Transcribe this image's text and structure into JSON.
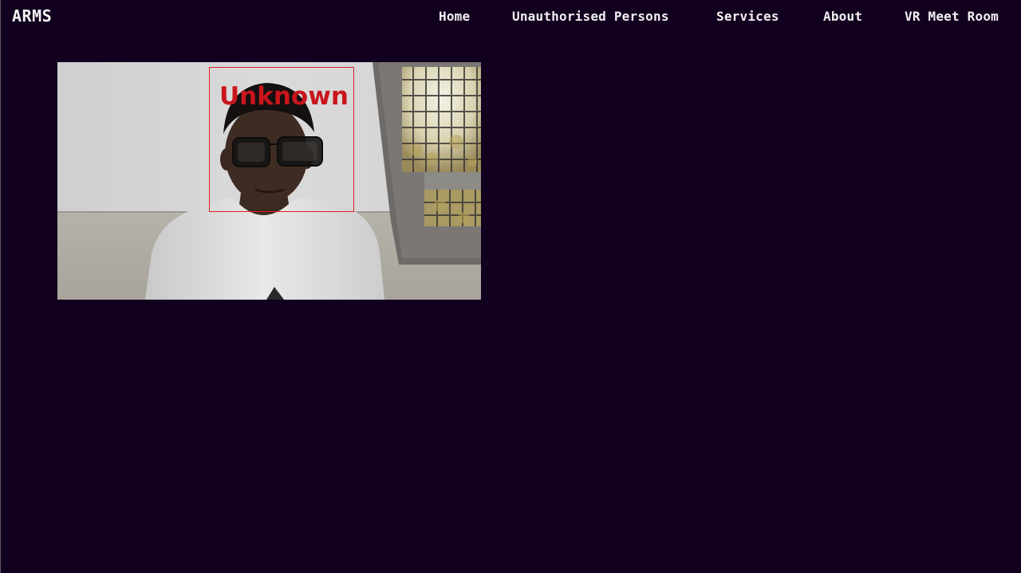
{
  "brand": {
    "name": "ARMS"
  },
  "nav": {
    "items": [
      {
        "label": "Home"
      },
      {
        "label": "Unauthorised Persons"
      },
      {
        "label": "Services"
      },
      {
        "label": "About"
      },
      {
        "label": "VR Meet Room"
      }
    ]
  },
  "camera": {
    "detection_label": "Unknown",
    "detection_color": "#c8161c"
  },
  "colors": {
    "background": "#12001f",
    "nav_text": "#f0f0f0"
  }
}
